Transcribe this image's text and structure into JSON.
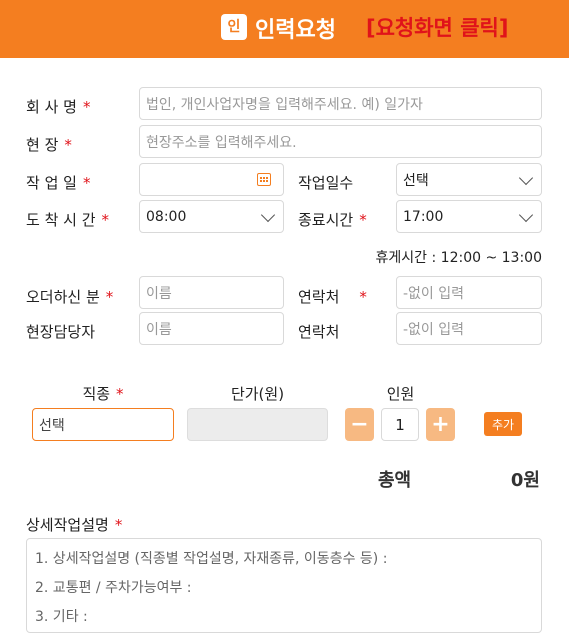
{
  "header": {
    "logo_glyph": "인",
    "title": "인력요청",
    "link": "[요청화면 클릭]"
  },
  "form": {
    "company": {
      "label": "회 사 명",
      "req": "*",
      "placeholder": "법인, 개인사업자명을 입력해주세요. 예) 일가자"
    },
    "site": {
      "label": "현 장",
      "req": "*",
      "placeholder": "현장주소를 입력해주세요."
    },
    "workdate": {
      "label": "작 업 일",
      "req": "*",
      "value": ""
    },
    "workdays": {
      "label": "작업일수",
      "value": "선택"
    },
    "arrival": {
      "label": "도 착 시 간",
      "req": "*",
      "value": "08:00"
    },
    "endtime": {
      "label": "종료시간",
      "req": "*",
      "value": "17:00"
    },
    "break_text": "휴게시간 : 12:00 ~ 13:00",
    "orderer": {
      "label": "오더하신 분",
      "req": "*",
      "placeholder": "이름"
    },
    "orderer_contact": {
      "label": "연락처",
      "req": "*",
      "placeholder": "-없이 입력"
    },
    "manager": {
      "label": "현장담당자",
      "placeholder": "이름"
    },
    "manager_contact": {
      "label": "연락처",
      "placeholder": "-없이 입력"
    }
  },
  "job": {
    "col_job": "직종",
    "col_job_req": "*",
    "col_price": "단가(원)",
    "col_count": "인원",
    "job_value": "선택",
    "minus": "−",
    "plus": "+",
    "qty": "1",
    "add": "추가"
  },
  "total": {
    "label": "총액",
    "value": "0원"
  },
  "detail": {
    "label": "상세작업설명",
    "req": "*",
    "lines": [
      "1. 상세작업설명 (직종별 작업설명, 자재종류, 이동층수 등) :",
      "2. 교통편 / 주차가능여부 :",
      "3. 기타 :"
    ]
  }
}
